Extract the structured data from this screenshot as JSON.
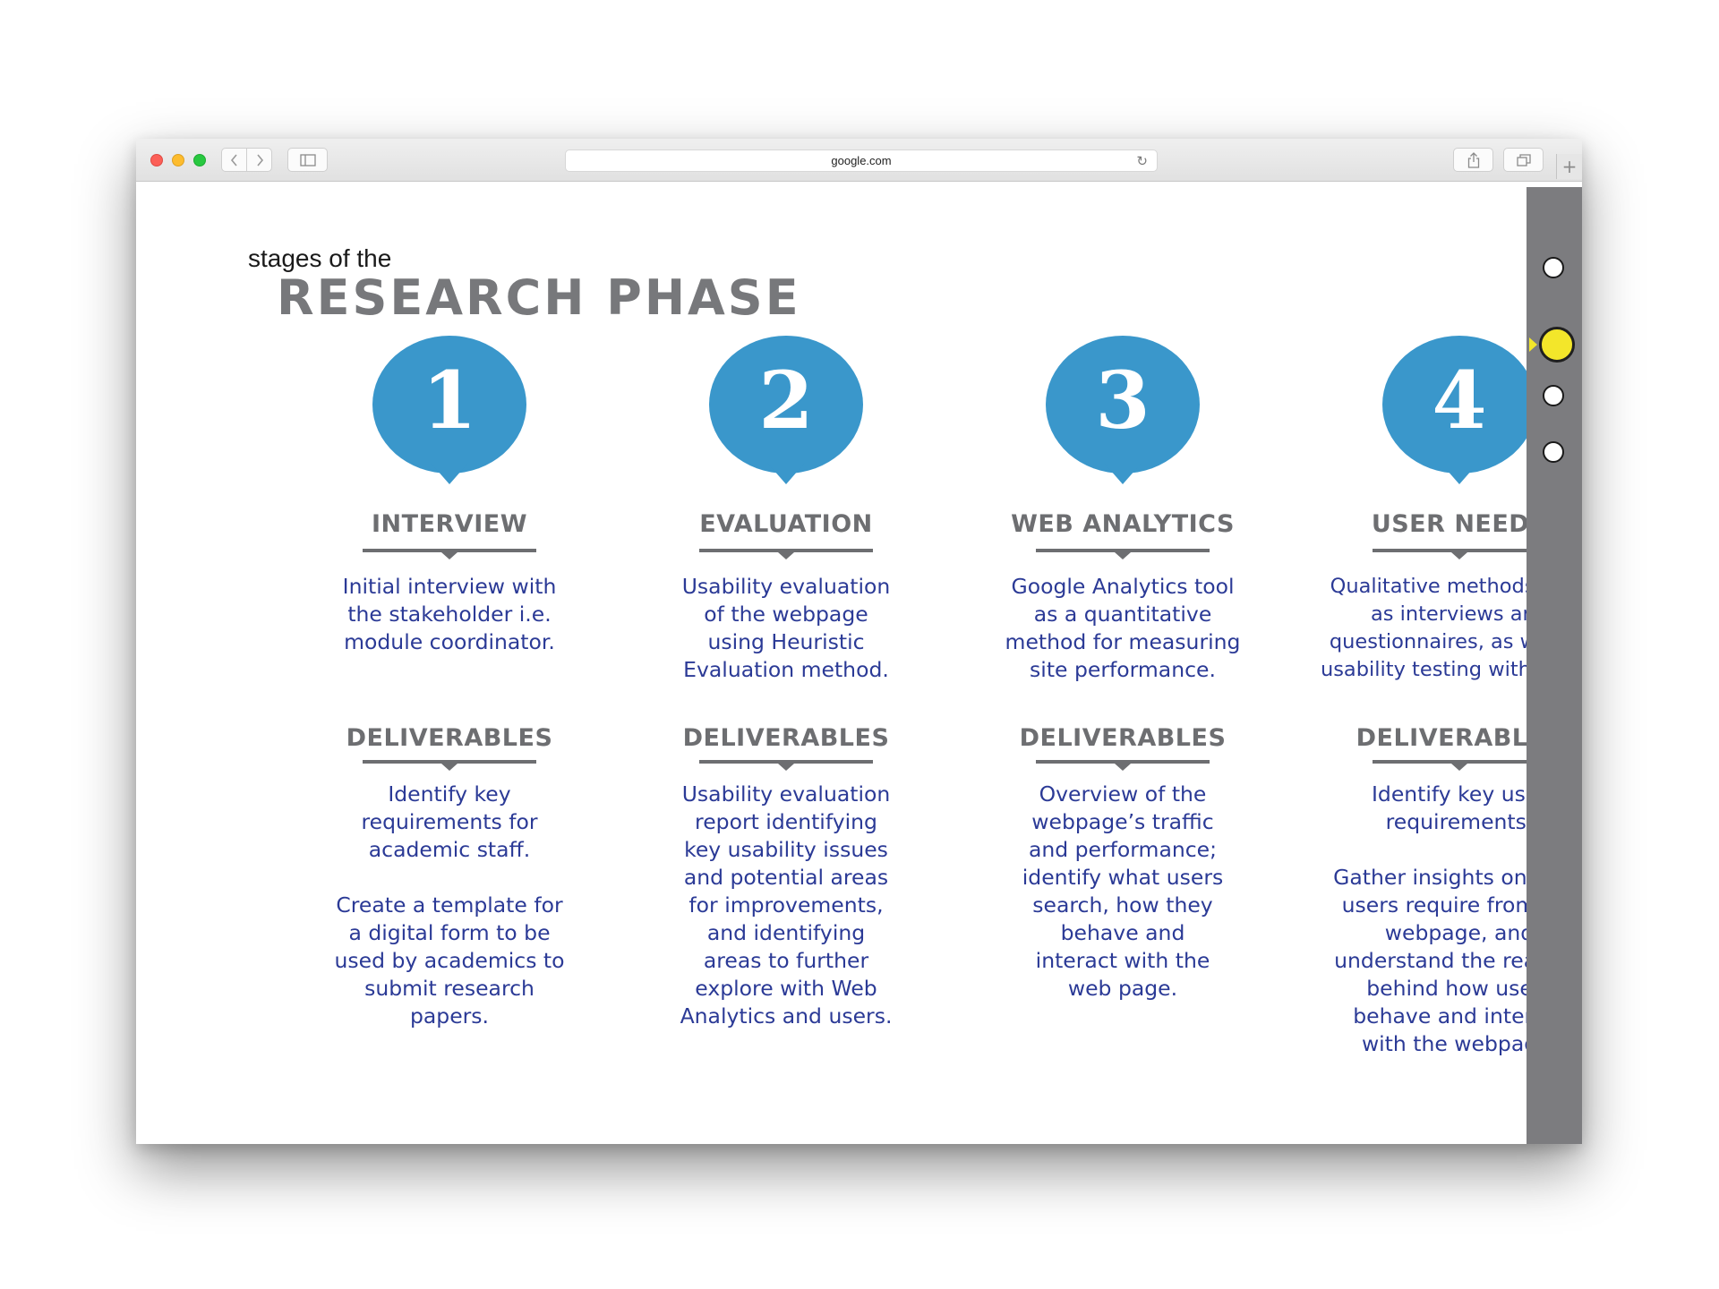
{
  "browser": {
    "url": "google.com",
    "icons": {
      "back": "chevron-left-icon",
      "forward": "chevron-right-icon",
      "sidebar": "sidebar-icon",
      "reload": "reload-icon",
      "share": "share-icon",
      "tabs": "tabs-icon",
      "new_tab": "plus-icon"
    }
  },
  "slide": {
    "subtitle": "stages of the",
    "title": "RESEARCH PHASE",
    "accent_color": "#3a97cb",
    "text_color": "#2b3a96",
    "stages": [
      {
        "number": "1",
        "heading": "INTERVIEW",
        "description": "Initial interview with\nthe stakeholder i.e.\nmodule coordinator.",
        "deliverables_heading": "DELIVERABLES",
        "deliverables": "Identify key\nrequirements for\nacademic staff.\n\nCreate a template for\na digital form to be\nused by academics to\nsubmit research\npapers."
      },
      {
        "number": "2",
        "heading": "EVALUATION",
        "description": "Usability evaluation\nof the webpage\nusing Heuristic\nEvaluation method.",
        "deliverables_heading": "DELIVERABLES",
        "deliverables": "Usability evaluation\nreport identifying\nkey usability issues\nand potential areas\nfor improvements,\nand identifying\nareas to further\nexplore with Web\nAnalytics and users."
      },
      {
        "number": "3",
        "heading": "WEB ANALYTICS",
        "description": "Google Analytics tool\nas a quantitative\nmethod for measuring\nsite performance.",
        "deliverables_heading": "DELIVERABLES",
        "deliverables": "Overview of the\nwebpage’s traffic\nand performance;\nidentify what users\nsearch, how they\nbehave and\ninteract with the\nweb page."
      },
      {
        "number": "4",
        "heading": "USER NEEDS",
        "description": "Qualitative methods such\nas interviews and\nquestionnaires, as well as\nusability testing with users.",
        "deliverables_heading": "DELIVERABLES",
        "deliverables": "Identify key user\nrequirements.\n\nGather insights on what\nusers require from the\nwebpage, and\nunderstand the reasons\nbehind how users\nbehave and interact\nwith the webpage."
      }
    ]
  },
  "navigator": {
    "count": 4,
    "active_index": 1,
    "active_color": "#f3e62a"
  }
}
